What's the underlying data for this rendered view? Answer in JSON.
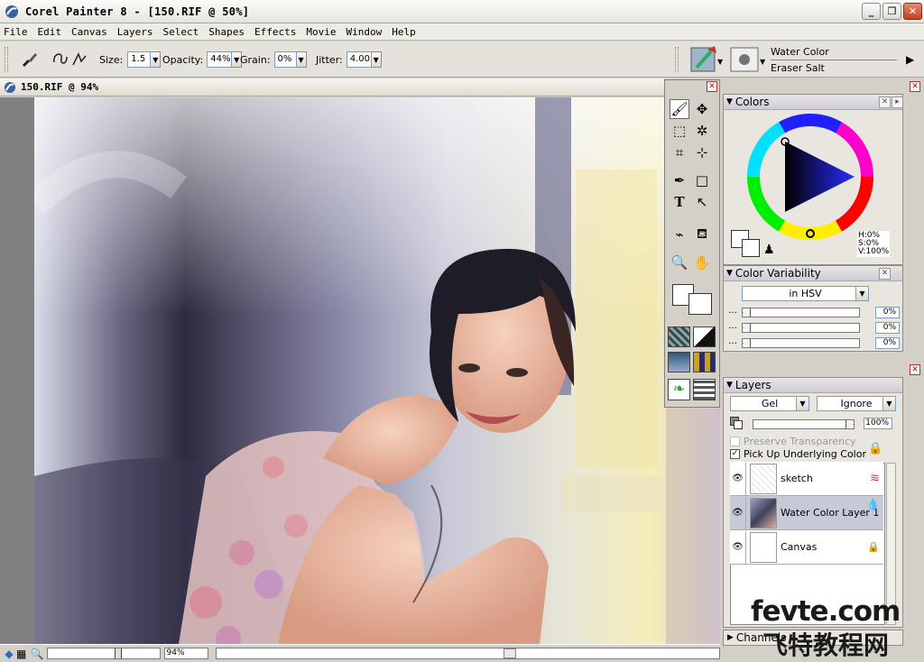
{
  "window": {
    "title": "Corel Painter 8 - [150.RIF @ 50%]",
    "minimize": "_",
    "restore": "❐",
    "close": "✕"
  },
  "menu": [
    "File",
    "Edit",
    "Canvas",
    "Layers",
    "Select",
    "Shapes",
    "Effects",
    "Movie",
    "Window",
    "Help"
  ],
  "properties": {
    "size_label": "Size:",
    "size_value": "1.5",
    "opacity_label": "Opacity:",
    "opacity_value": "44%",
    "grain_label": "Grain:",
    "grain_value": "0%",
    "jitter_label": "Jitter:",
    "jitter_value": "4.00",
    "brush_category": "Water Color",
    "brush_variant": "Eraser Salt"
  },
  "document": {
    "title": "150.RIF @ 94%",
    "zoom": "94%"
  },
  "toolbox": {
    "close": "✕"
  },
  "colors_panel": {
    "title": "Colors",
    "h": "H:0%",
    "s": "S:0%",
    "v": "V:100%"
  },
  "variability_panel": {
    "title": "Color Variability",
    "mode": "in HSV",
    "values": [
      "0%",
      "0%",
      "0%"
    ]
  },
  "layers_panel": {
    "title": "Layers",
    "composite_method": "Gel",
    "depth": "Ignore",
    "opacity": "100%",
    "preserve_transparency": "Preserve Transparency",
    "pick_up_color": "Pick Up Underlying Color",
    "layers": [
      {
        "name": "sketch"
      },
      {
        "name": "Water Color Layer 1"
      },
      {
        "name": "Canvas"
      }
    ]
  },
  "channels_panel": {
    "title": "Channels"
  },
  "watermark": {
    "line1": "fevte.com",
    "line2": "飞特教程网"
  }
}
